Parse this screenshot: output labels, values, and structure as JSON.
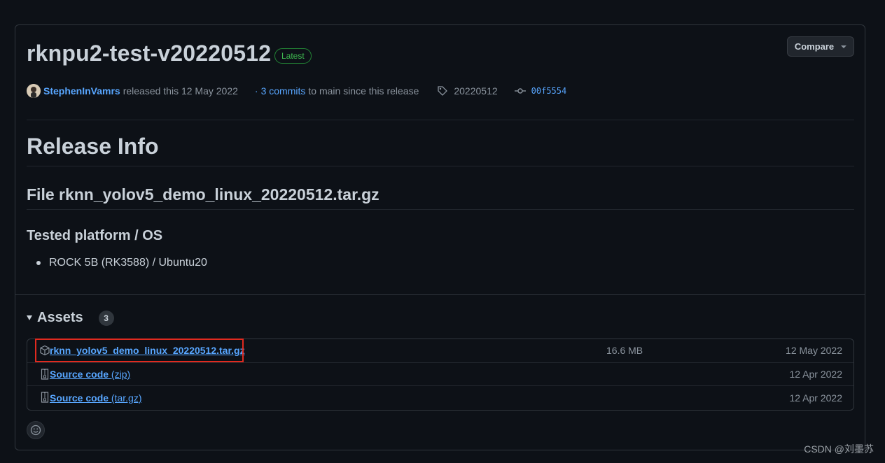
{
  "release": {
    "title": "rknpu2-test-v20220512",
    "badge": "Latest",
    "compare_label": "Compare",
    "author": "StephenInVamrs",
    "released_text": "released this 12 May 2022",
    "commits_prefix": "·",
    "commits_link": "3 commits",
    "commits_suffix": "to main since this release",
    "tag": "20220512",
    "commit_hash": "00f5554"
  },
  "body": {
    "h1": "Release Info",
    "h2": "File rknn_yolov5_demo_linux_20220512.tar.gz",
    "h3": "Tested platform / OS",
    "bullets": [
      "ROCK 5B (RK3588) / Ubuntu20"
    ]
  },
  "assets": {
    "heading": "Assets",
    "count": "3",
    "items": [
      {
        "name": "rknn_yolov5_demo_linux_20220512.tar.gz",
        "size": "16.6 MB",
        "date": "12 May 2022"
      },
      {
        "name": "Source code",
        "ext": "(zip)",
        "size": "",
        "date": "12 Apr 2022"
      },
      {
        "name": "Source code",
        "ext": "(tar.gz)",
        "size": "",
        "date": "12 Apr 2022"
      }
    ]
  },
  "watermark": "CSDN @刘墨苏",
  "colors": {
    "accent": "#58a6ff",
    "badge_green": "#3fb950",
    "highlight_red": "#e02a1f",
    "bg": "#0d1117"
  }
}
